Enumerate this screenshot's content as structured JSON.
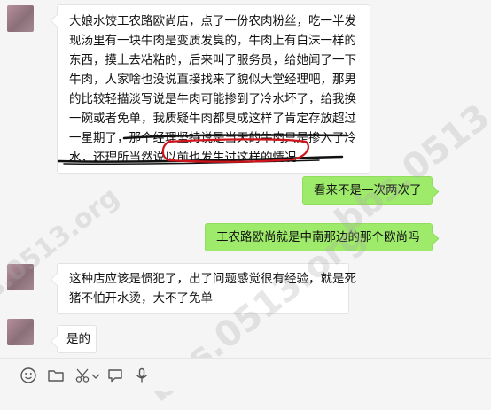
{
  "messages": [
    {
      "id": "m1",
      "side": "left",
      "lines": [
        "大娘水饺工农路欧尚店，点了一份农肉粉丝，吃一半发",
        "现汤里有一块牛肉是变质发臭的，牛肉上有白沫一样的",
        "东西，摸上去粘粘的，后来叫了服务员，给她闻了一下",
        "牛肉，人家啥也没说直接找来了貌似大堂经理吧，那男",
        "的比较轻描淡写说是牛肉可能掺到了冷水坏了，给我换",
        "一碗或者免单，我质疑牛肉都臭成这样了肯定存放超过",
        "一星期了，那个经理坚持说是当天的牛肉只是掺入了冷",
        "水，还理所当然说以前也发生过这样的情况"
      ]
    },
    {
      "id": "m2",
      "side": "right",
      "text": "看来不是一次两次了"
    },
    {
      "id": "m3",
      "side": "right",
      "text": "工农路欧尚就是中南那边的那个欧尚吗"
    },
    {
      "id": "m4",
      "side": "left",
      "lines": [
        "这种店应该是惯犯了，出了问题感觉很有经验，就是死",
        "猪不怕开水烫，大不了免单"
      ]
    },
    {
      "id": "m5",
      "side": "left",
      "text": "是的"
    }
  ],
  "annotations": {
    "ink_color": "#111111",
    "circle_color": "#d0141c"
  },
  "colors": {
    "background": "#f5f5f5",
    "self_bubble": "#9eea6a",
    "other_bubble": "#ffffff"
  },
  "toolbar": {
    "icons": [
      "emoji-icon",
      "folder-icon",
      "scissors-icon",
      "chat-history-icon",
      "voice-icon"
    ]
  },
  "watermark": {
    "text": "bbs.0513.org"
  }
}
